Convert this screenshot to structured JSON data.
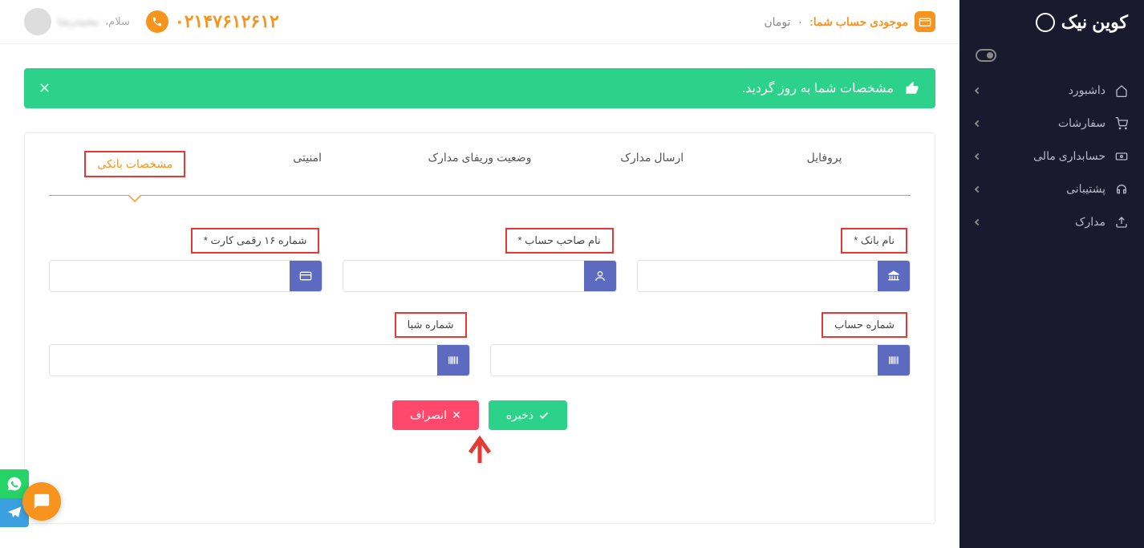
{
  "brand": "کوین نیک",
  "sidebar": {
    "items": [
      {
        "label": "داشبورد"
      },
      {
        "label": "سفارشات"
      },
      {
        "label": "حسابداری مالی"
      },
      {
        "label": "پشتیبانی"
      },
      {
        "label": "مدارک"
      }
    ]
  },
  "topbar": {
    "balance_label": "موجودی حساب شما:",
    "balance_value": "۰",
    "balance_unit": "تومان",
    "phone": "۰۲۱۴۷۶۱۲۶۱۲",
    "greeting": "سلام،",
    "username": "محمدرضا"
  },
  "alert": {
    "text": "مشخصات شما به روز گردید."
  },
  "tabs": [
    {
      "label": "پروفایل"
    },
    {
      "label": "ارسال مدارک"
    },
    {
      "label": "وضعیت وریفای مدارک"
    },
    {
      "label": "امنیتی"
    },
    {
      "label": "مشخصات بانکی"
    }
  ],
  "form": {
    "bank_name": "نام بانک *",
    "account_owner": "نام صاحب حساب *",
    "card_number": "شماره ۱۶ رقمی کارت *",
    "account_number": "شماره حساب",
    "sheba": "شماره شبا"
  },
  "buttons": {
    "save": "ذخیره",
    "cancel": "انصراف"
  }
}
